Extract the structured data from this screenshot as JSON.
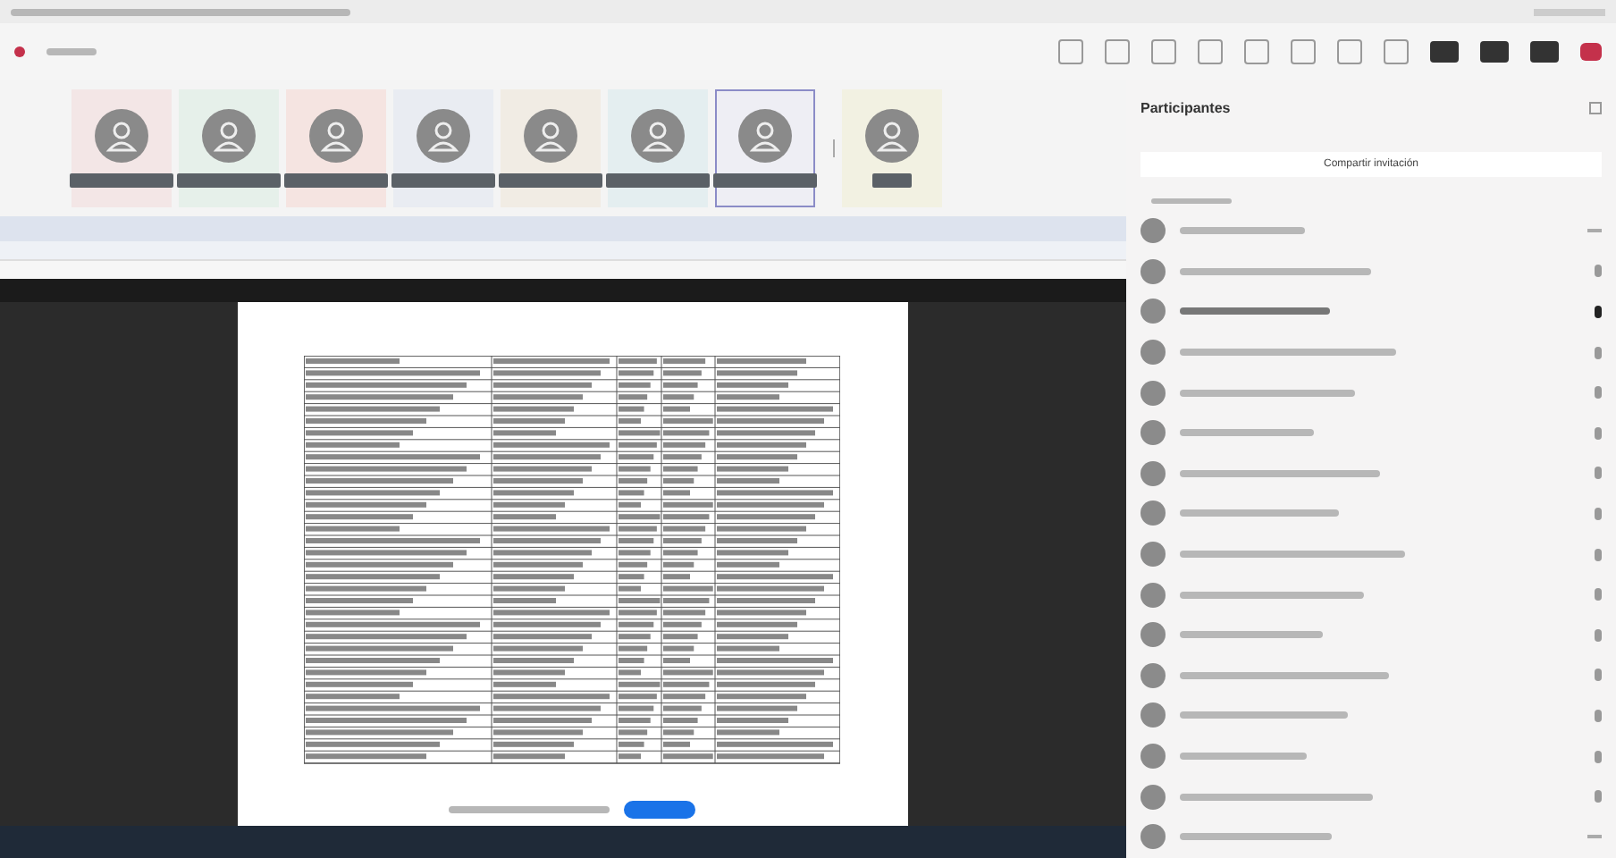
{
  "tiles": [
    {
      "color": "#f3e6e6",
      "selected": false
    },
    {
      "color": "#e6f0ea",
      "selected": false
    },
    {
      "color": "#f5e4e1",
      "selected": false
    },
    {
      "color": "#e9ecf2",
      "selected": false
    },
    {
      "color": "#f1ece4",
      "selected": false
    },
    {
      "color": "#e4eef0",
      "selected": false
    },
    {
      "color": "#eeeef4",
      "selected": true
    },
    {
      "color": "#f2f1e2",
      "selected": false
    }
  ],
  "panel": {
    "title": "Participantes",
    "invite_button": "Compartir invitación"
  },
  "participants": [
    {
      "kind": "menu",
      "speaking": false
    },
    {
      "kind": "mic",
      "speaking": false
    },
    {
      "kind": "mic",
      "speaking": true
    },
    {
      "kind": "mic",
      "speaking": false
    },
    {
      "kind": "mic",
      "speaking": false
    },
    {
      "kind": "mic",
      "speaking": false
    },
    {
      "kind": "mic",
      "speaking": false
    },
    {
      "kind": "mic",
      "speaking": false
    },
    {
      "kind": "mic",
      "speaking": false
    },
    {
      "kind": "mic",
      "speaking": false
    },
    {
      "kind": "mic",
      "speaking": false
    },
    {
      "kind": "mic",
      "speaking": false
    },
    {
      "kind": "mic",
      "speaking": false
    },
    {
      "kind": "mic",
      "speaking": false
    },
    {
      "kind": "mic",
      "speaking": false
    },
    {
      "kind": "menu",
      "speaking": false
    }
  ]
}
